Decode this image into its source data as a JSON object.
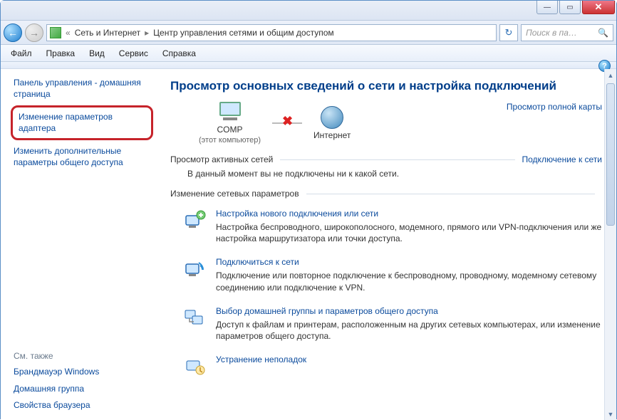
{
  "titlebar": {
    "minimize": "—",
    "maximize": "▭",
    "close": "✕"
  },
  "nav": {
    "back": "←",
    "forward": "→"
  },
  "address": {
    "pre": "«",
    "part1": "Сеть и Интернет",
    "part2": "Центр управления сетями и общим доступом",
    "refresh": "↻"
  },
  "search": {
    "placeholder": "Поиск в па…",
    "icon": "🔍"
  },
  "menubar": [
    "Файл",
    "Правка",
    "Вид",
    "Сервис",
    "Справка"
  ],
  "help": "?",
  "sidebar": {
    "cp_home": "Панель управления - домашняя страница",
    "adapter": "Изменение параметров адаптера",
    "sharing": "Изменить дополнительные параметры общего доступа",
    "see_also": "См. также",
    "firewall": "Брандмауэр Windows",
    "homegroup": "Домашняя группа",
    "browser": "Свойства браузера"
  },
  "main": {
    "title": "Просмотр основных сведений о сети и настройка подключений",
    "full_map": "Просмотр полной карты",
    "node_comp": "COMP",
    "node_comp_sub": "(этот компьютер)",
    "node_net": "Интернет",
    "active_head": "Просмотр активных сетей",
    "connect_link": "Подключение к сети",
    "active_info": "В данный момент вы не подключены ни к какой сети.",
    "change_head": "Изменение сетевых параметров",
    "opts": [
      {
        "title": "Настройка нового подключения или сети",
        "desc": "Настройка беспроводного, широкополосного, модемного, прямого или VPN-подключения или же настройка маршрутизатора или точки доступа."
      },
      {
        "title": "Подключиться к сети",
        "desc": "Подключение или повторное подключение к беспроводному, проводному, модемному сетевому соединению или подключение к VPN."
      },
      {
        "title": "Выбор домашней группы и параметров общего доступа",
        "desc": "Доступ к файлам и принтерам, расположенным на других сетевых компьютерах, или изменение параметров общего доступа."
      },
      {
        "title": "Устранение неполадок",
        "desc": ""
      }
    ]
  }
}
